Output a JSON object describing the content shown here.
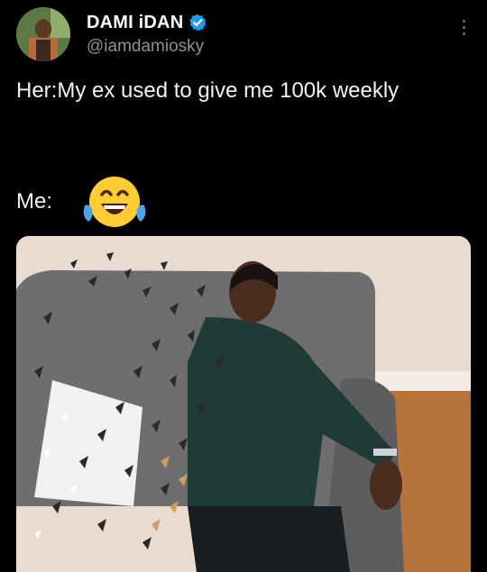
{
  "author": {
    "display_name": "DAMI iDAN",
    "handle": "@iamdamiosky",
    "verified": true
  },
  "tweet": {
    "line1": "Her:My ex used to give me 100k weekly",
    "me_label": "Me:",
    "emoji": "face-with-tears-of-joy"
  },
  "colors": {
    "background": "#000000",
    "verified_blue": "#1d9bf0",
    "handle_gray": "#8b9298"
  },
  "icons": {
    "verified": "verified-badge-icon",
    "more": "more-options-icon"
  }
}
